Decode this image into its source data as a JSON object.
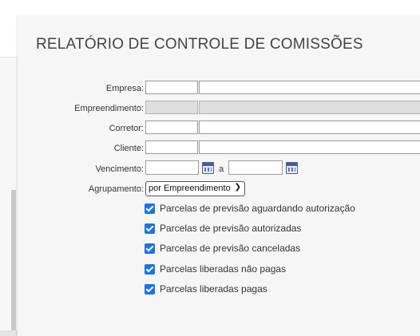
{
  "title": "RELATÓRIO DE CONTROLE DE COMISSÕES",
  "fields": {
    "empresa": {
      "label": "Empresa:",
      "code": "",
      "description": ""
    },
    "empreendimento": {
      "label": "Empreendimento:",
      "code": "",
      "description": ""
    },
    "corretor": {
      "label": "Corretor:",
      "code": "",
      "description": ""
    },
    "cliente": {
      "label": "Cliente:",
      "code": "",
      "description": ""
    }
  },
  "vencimento": {
    "label": "Vencimento:",
    "from": "",
    "separator": "a",
    "to": ""
  },
  "agrupamento": {
    "label": "Agrupamento:",
    "selected": "por Empreendimento"
  },
  "checkboxes": [
    {
      "label": "Parcelas de previsão aguardando autorização",
      "checked": true
    },
    {
      "label": "Parcelas de previsão autorizadas",
      "checked": true
    },
    {
      "label": "Parcelas de previsão canceladas",
      "checked": true
    },
    {
      "label": "Parcelas liberadas não pagas",
      "checked": true
    },
    {
      "label": "Parcelas liberadas pagas",
      "checked": true
    }
  ],
  "colors": {
    "accent": "#1a73e8",
    "calendar": "#4a5d94"
  },
  "icons": {
    "date_picker": "calendar-icon",
    "dropdown": "chevron-down-icon",
    "check": "checkmark"
  }
}
